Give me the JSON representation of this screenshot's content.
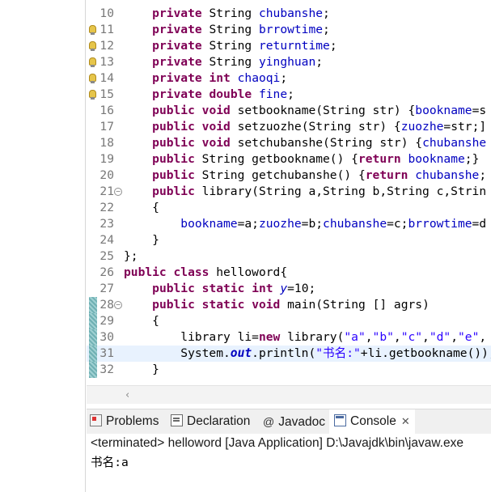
{
  "editor": {
    "lines": [
      {
        "num": "10",
        "marker": "none",
        "fold": false,
        "current": false,
        "tokens": [
          {
            "t": "    "
          },
          {
            "t": "private",
            "c": "kw"
          },
          {
            "t": " String "
          },
          {
            "t": "chubanshe",
            "c": "fld"
          },
          {
            "t": ";"
          }
        ]
      },
      {
        "num": "11",
        "marker": "bulb",
        "fold": false,
        "current": false,
        "tokens": [
          {
            "t": "    "
          },
          {
            "t": "private",
            "c": "kw"
          },
          {
            "t": " String "
          },
          {
            "t": "brrowtime",
            "c": "fld"
          },
          {
            "t": ";"
          }
        ]
      },
      {
        "num": "12",
        "marker": "bulb",
        "fold": false,
        "current": false,
        "tokens": [
          {
            "t": "    "
          },
          {
            "t": "private",
            "c": "kw"
          },
          {
            "t": " String "
          },
          {
            "t": "returntime",
            "c": "fld"
          },
          {
            "t": ";"
          }
        ]
      },
      {
        "num": "13",
        "marker": "bulb",
        "fold": false,
        "current": false,
        "tokens": [
          {
            "t": "    "
          },
          {
            "t": "private",
            "c": "kw"
          },
          {
            "t": " String "
          },
          {
            "t": "yinghuan",
            "c": "fld"
          },
          {
            "t": ";"
          }
        ]
      },
      {
        "num": "14",
        "marker": "bulb",
        "fold": false,
        "current": false,
        "tokens": [
          {
            "t": "    "
          },
          {
            "t": "private",
            "c": "kw"
          },
          {
            "t": " "
          },
          {
            "t": "int",
            "c": "kw"
          },
          {
            "t": " "
          },
          {
            "t": "chaoqi",
            "c": "fld"
          },
          {
            "t": ";"
          }
        ]
      },
      {
        "num": "15",
        "marker": "bulb",
        "fold": false,
        "current": false,
        "tokens": [
          {
            "t": "    "
          },
          {
            "t": "private",
            "c": "kw"
          },
          {
            "t": " "
          },
          {
            "t": "double",
            "c": "kw"
          },
          {
            "t": " "
          },
          {
            "t": "fine",
            "c": "fld"
          },
          {
            "t": ";"
          }
        ]
      },
      {
        "num": "16",
        "marker": "none",
        "fold": false,
        "current": false,
        "tokens": [
          {
            "t": "    "
          },
          {
            "t": "public",
            "c": "kw"
          },
          {
            "t": " "
          },
          {
            "t": "void",
            "c": "kw"
          },
          {
            "t": " setbookname(String str) {"
          },
          {
            "t": "bookname",
            "c": "fld"
          },
          {
            "t": "=s"
          }
        ]
      },
      {
        "num": "17",
        "marker": "none",
        "fold": false,
        "current": false,
        "tokens": [
          {
            "t": "    "
          },
          {
            "t": "public",
            "c": "kw"
          },
          {
            "t": " "
          },
          {
            "t": "void",
            "c": "kw"
          },
          {
            "t": " setzuozhe(String str) {"
          },
          {
            "t": "zuozhe",
            "c": "fld"
          },
          {
            "t": "=str;]"
          }
        ]
      },
      {
        "num": "18",
        "marker": "none",
        "fold": false,
        "current": false,
        "tokens": [
          {
            "t": "    "
          },
          {
            "t": "public",
            "c": "kw"
          },
          {
            "t": " "
          },
          {
            "t": "void",
            "c": "kw"
          },
          {
            "t": " setchubanshe(String str) {"
          },
          {
            "t": "chubanshe",
            "c": "fld"
          }
        ]
      },
      {
        "num": "19",
        "marker": "none",
        "fold": false,
        "current": false,
        "tokens": [
          {
            "t": "    "
          },
          {
            "t": "public",
            "c": "kw"
          },
          {
            "t": " String getbookname() {"
          },
          {
            "t": "return",
            "c": "kw"
          },
          {
            "t": " "
          },
          {
            "t": "bookname",
            "c": "fld"
          },
          {
            "t": ";}"
          }
        ]
      },
      {
        "num": "20",
        "marker": "none",
        "fold": false,
        "current": false,
        "tokens": [
          {
            "t": "    "
          },
          {
            "t": "public",
            "c": "kw"
          },
          {
            "t": " String getchubanshe() {"
          },
          {
            "t": "return",
            "c": "kw"
          },
          {
            "t": " "
          },
          {
            "t": "chubanshe",
            "c": "fld"
          },
          {
            "t": ";"
          }
        ]
      },
      {
        "num": "21",
        "marker": "none",
        "fold": true,
        "current": false,
        "tokens": [
          {
            "t": "    "
          },
          {
            "t": "public",
            "c": "kw"
          },
          {
            "t": " library(String a,String b,String c,Strin"
          }
        ]
      },
      {
        "num": "22",
        "marker": "none",
        "fold": false,
        "current": false,
        "tokens": [
          {
            "t": "    {"
          }
        ]
      },
      {
        "num": "23",
        "marker": "none",
        "fold": false,
        "current": false,
        "tokens": [
          {
            "t": "        "
          },
          {
            "t": "bookname",
            "c": "fld"
          },
          {
            "t": "=a;"
          },
          {
            "t": "zuozhe",
            "c": "fld"
          },
          {
            "t": "=b;"
          },
          {
            "t": "chubanshe",
            "c": "fld"
          },
          {
            "t": "=c;"
          },
          {
            "t": "brrowtime",
            "c": "fld"
          },
          {
            "t": "=d"
          }
        ]
      },
      {
        "num": "24",
        "marker": "none",
        "fold": false,
        "current": false,
        "tokens": [
          {
            "t": "    }"
          }
        ]
      },
      {
        "num": "25",
        "marker": "none",
        "fold": false,
        "current": false,
        "tokens": [
          {
            "t": "};"
          }
        ]
      },
      {
        "num": "26",
        "marker": "none",
        "fold": false,
        "current": false,
        "tokens": [
          {
            "t": "public",
            "c": "kw"
          },
          {
            "t": " "
          },
          {
            "t": "class",
            "c": "kw"
          },
          {
            "t": " helloword{"
          }
        ]
      },
      {
        "num": "27",
        "marker": "none",
        "fold": false,
        "current": false,
        "tokens": [
          {
            "t": "    "
          },
          {
            "t": "public",
            "c": "kw"
          },
          {
            "t": " "
          },
          {
            "t": "static",
            "c": "kw"
          },
          {
            "t": " "
          },
          {
            "t": "int",
            "c": "kw"
          },
          {
            "t": " "
          },
          {
            "t": "y",
            "c": "stf"
          },
          {
            "t": "=10;"
          }
        ]
      },
      {
        "num": "28",
        "marker": "block",
        "fold": true,
        "current": false,
        "tokens": [
          {
            "t": "    "
          },
          {
            "t": "public",
            "c": "kw"
          },
          {
            "t": " "
          },
          {
            "t": "static",
            "c": "kw"
          },
          {
            "t": " "
          },
          {
            "t": "void",
            "c": "kw"
          },
          {
            "t": " main(String [] agrs)"
          }
        ]
      },
      {
        "num": "29",
        "marker": "block",
        "fold": false,
        "current": false,
        "tokens": [
          {
            "t": "    {"
          }
        ]
      },
      {
        "num": "30",
        "marker": "block",
        "fold": false,
        "current": false,
        "tokens": [
          {
            "t": "        library li="
          },
          {
            "t": "new",
            "c": "kw"
          },
          {
            "t": " library("
          },
          {
            "t": "\"a\"",
            "c": "str"
          },
          {
            "t": ","
          },
          {
            "t": "\"b\"",
            "c": "str"
          },
          {
            "t": ","
          },
          {
            "t": "\"c\"",
            "c": "str"
          },
          {
            "t": ","
          },
          {
            "t": "\"d\"",
            "c": "str"
          },
          {
            "t": ","
          },
          {
            "t": "\"e\"",
            "c": "str"
          },
          {
            "t": ","
          }
        ]
      },
      {
        "num": "31",
        "marker": "block",
        "fold": false,
        "current": true,
        "tokens": [
          {
            "t": "        System."
          },
          {
            "t": "out",
            "c": "stat"
          },
          {
            "t": ".println("
          },
          {
            "t": "\"书名:\"",
            "c": "str"
          },
          {
            "t": "+li.getbookname());"
          }
        ]
      },
      {
        "num": "32",
        "marker": "block",
        "fold": false,
        "current": false,
        "tokens": [
          {
            "t": "    }"
          }
        ]
      }
    ]
  },
  "bottom_panel": {
    "tabs": [
      {
        "id": "problems",
        "label": "Problems",
        "icon": "problems-icon",
        "active": false
      },
      {
        "id": "declaration",
        "label": "Declaration",
        "icon": "declaration-icon",
        "active": false
      },
      {
        "id": "javadoc",
        "label": "Javadoc",
        "icon": "javadoc-icon",
        "active": false
      },
      {
        "id": "console",
        "label": "Console",
        "icon": "console-icon",
        "active": true,
        "close": "✕"
      }
    ],
    "javadoc_glyph": "@",
    "console_status": "<terminated> helloword [Java Application] D:\\Javajdk\\bin\\javaw.exe",
    "console_output": "书名:a"
  }
}
